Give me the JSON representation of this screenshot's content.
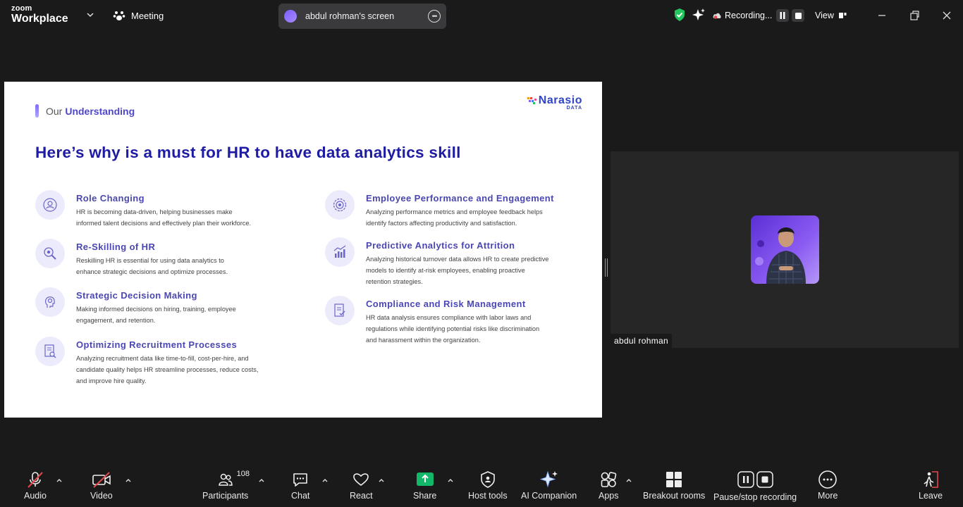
{
  "app": {
    "brand_top": "zoom",
    "brand_bottom": "Workplace",
    "meeting_label": "Meeting"
  },
  "share_pill": {
    "text": "abdul rohman's screen"
  },
  "recording": {
    "label": "Recording...",
    "view_label": "View"
  },
  "slide": {
    "eyebrow_1": "Our",
    "eyebrow_2": "Understanding",
    "logo_name": "Narasio",
    "logo_sub": "DATA",
    "headline": "Here’s why is a must for HR to have data analytics skill",
    "left_items": [
      {
        "title": "Role Changing",
        "body": "HR is becoming data-driven, helping businesses make\ninformed talent decisions and effectively plan their workforce.",
        "icon": "person-cycle-icon"
      },
      {
        "title": "Re-Skilling of HR",
        "body": "Reskilling HR is essential for using data analytics to\nenhance strategic decisions and optimize processes.",
        "icon": "magnifier-gear-icon"
      },
      {
        "title": "Strategic Decision Making",
        "body": "Making informed decisions on hiring, training, employee\nengagement, and retention.",
        "icon": "head-lightbulb-icon"
      },
      {
        "title": "Optimizing Recruitment Processes",
        "body": "Analyzing recruitment data like time-to-fill, cost-per-hire, and\ncandidate quality helps HR streamline processes, reduce costs,\nand improve hire quality.",
        "icon": "document-search-icon"
      }
    ],
    "right_items": [
      {
        "title": "Employee Performance and Engagement",
        "body": "Analyzing performance metrics and employee feedback helps\nidentify factors affecting productivity and satisfaction.",
        "icon": "target-gear-icon"
      },
      {
        "title": "Predictive Analytics for Attrition",
        "body": "Analyzing historical turnover data allows HR to create predictive\nmodels to identify at-risk employees, enabling proactive\nretention strategies.",
        "icon": "bar-trend-icon"
      },
      {
        "title": "Compliance and Risk Management",
        "body": "HR data analysis ensures compliance with labor laws and\nregulations while identifying potential risks like discrimination\nand harassment within the organization.",
        "icon": "checklist-icon"
      }
    ]
  },
  "participant": {
    "name": "abdul rohman"
  },
  "toolbar": {
    "audio": "Audio",
    "video": "Video",
    "participants": "Participants",
    "participants_count": "108",
    "chat": "Chat",
    "react": "React",
    "share": "Share",
    "host_tools": "Host tools",
    "ai_companion": "AI Companion",
    "apps": "Apps",
    "breakout": "Breakout rooms",
    "pause_stop": "Pause/stop recording",
    "more": "More",
    "leave": "Leave"
  },
  "colors": {
    "headline": "#1e1ba4",
    "item_title": "#4a47b3",
    "share_green": "#12b76a",
    "leave_red": "#e5484d",
    "shield_green": "#22c55e"
  }
}
